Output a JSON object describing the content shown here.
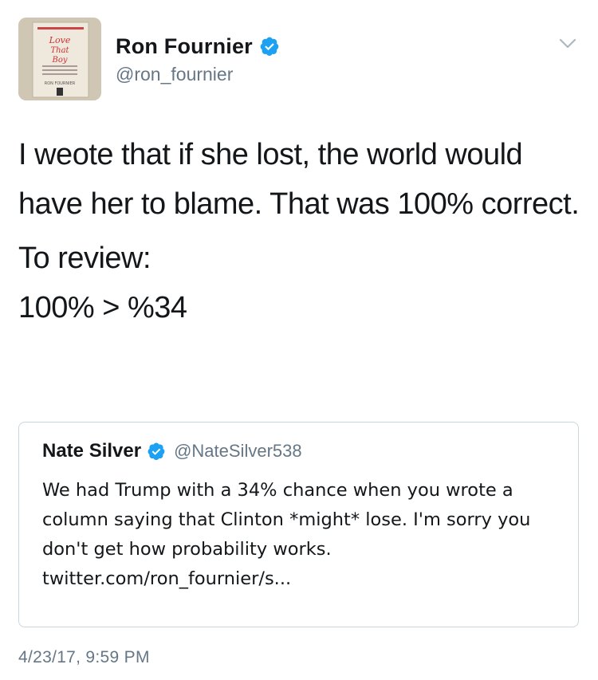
{
  "author": {
    "display_name": "Ron Fournier",
    "handle": "@ron_fournier",
    "verified": true,
    "avatar_book": {
      "title_line1": "Love",
      "title_line2": "That",
      "title_line3": "Boy",
      "author_text": "RON FOURNIER"
    }
  },
  "tweet": {
    "paragraph1": "I weote that if she lost, the world would have her to blame. That was 100% correct.",
    "paragraph2_line1": "To review:",
    "paragraph2_line2": "100% > %34",
    "timestamp": "4/23/17, 9:59 PM"
  },
  "quoted_tweet": {
    "display_name": "Nate Silver",
    "handle": "@NateSilver538",
    "verified": true,
    "text": "We had Trump with a 34% chance when you wrote a column saying that Clinton *might* lose. I'm sorry you don't get how probability works. twitter.com/ron_fournier/s..."
  },
  "colors": {
    "text_primary": "#14171a",
    "text_secondary": "#657786",
    "verified_blue": "#1da1f2",
    "card_border": "#ccd6dd"
  },
  "icons": {
    "verified": "verified-badge-icon",
    "menu": "chevron-down-icon"
  }
}
